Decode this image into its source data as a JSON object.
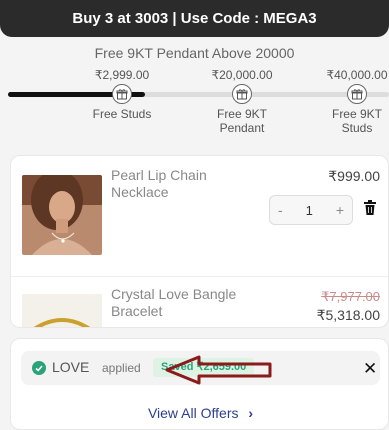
{
  "banner": {
    "text": "Buy 3 at 3003 | Use Code : MEGA3"
  },
  "offer": {
    "title": "Free 9KT Pendant Above 20000"
  },
  "progress": {
    "fraction_filled": 0.36,
    "milestones": [
      {
        "amount": "₹2,999.00",
        "label": "Free Studs",
        "icon": "gift-icon"
      },
      {
        "amount": "₹20,000.00",
        "label": "Free 9KT\nPendant",
        "icon": "gift-icon"
      },
      {
        "amount": "₹40,000.00",
        "label": "Free 9KT\nStuds",
        "icon": "gift-icon"
      }
    ]
  },
  "cart": {
    "items": [
      {
        "name": "Pearl Lip Chain Necklace",
        "price": "₹999.00",
        "quantity": "1",
        "minus": "-",
        "plus": "+"
      },
      {
        "name": "Crystal Love Bangle Bracelet",
        "original_price": "₹7,977.00",
        "price": "₹5,318.00"
      }
    ]
  },
  "coupon": {
    "code": "LOVE",
    "status": "applied",
    "saved": "Saved ₹2,659.00",
    "close": "✕"
  },
  "offers_link": {
    "label": "View All Offers",
    "chevron": "›"
  },
  "colors": {
    "banner_bg": "#2b2b2b",
    "accent_green": "#2aa37a",
    "link_blue": "#2a3f8f",
    "arrow": "#8b1a1a"
  }
}
